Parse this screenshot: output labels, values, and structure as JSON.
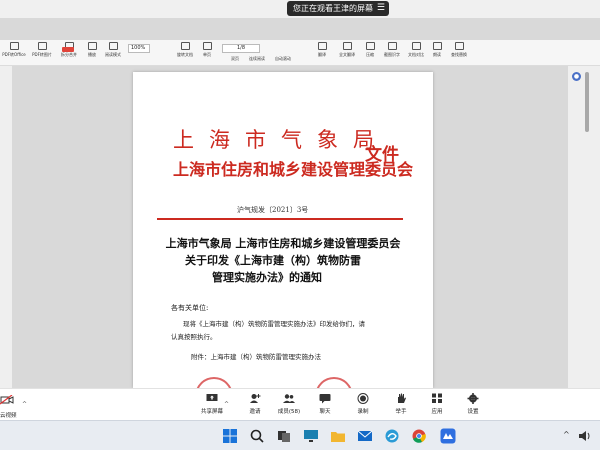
{
  "share_notice": {
    "text": "您正在观看王津的屏幕",
    "menu_icon": "menu-icon"
  },
  "toolbar": {
    "items": [
      {
        "label": "PDF转Office",
        "icon": "convert-icon"
      },
      {
        "label": "PDF转图片",
        "icon": "image-icon"
      },
      {
        "label": "拆分合并",
        "icon": "split-icon"
      },
      {
        "label": "播放",
        "icon": "play-icon"
      },
      {
        "label": "阅读模式",
        "icon": "read-icon"
      },
      {
        "label": "旋转文档",
        "icon": "rotate-icon"
      },
      {
        "label": "单页",
        "icon": "single-page-icon"
      },
      {
        "label": "双页",
        "icon": "double-page-icon"
      },
      {
        "label": "连续阅读",
        "icon": "continuous-icon"
      },
      {
        "label": "自动滚动",
        "icon": "autoscroll-icon"
      },
      {
        "label": "翻译",
        "icon": "translate-icon"
      },
      {
        "label": "全文翻译",
        "icon": "full-translate-icon"
      },
      {
        "label": "压缩",
        "icon": "compress-icon"
      },
      {
        "label": "截图识字",
        "icon": "ocr-icon"
      },
      {
        "label": "文档对比",
        "icon": "compare-icon"
      },
      {
        "label": "朗读",
        "icon": "speak-icon"
      },
      {
        "label": "查找替换",
        "icon": "search-icon"
      }
    ],
    "zoom": "100%",
    "page_indicator": "1/8",
    "view_single_label": "单页",
    "view_double_label": "双页",
    "view_continuous_label": "连续阅读",
    "autoscroll_label": "自动滚动",
    "screenshot_label": "截图识字"
  },
  "document": {
    "org_line1": "上海市气象局",
    "org_line2": "上海市住房和城乡建设管理委员会",
    "doc_type": "文件",
    "doc_number": "沪气规发〔2021〕3号",
    "title_line1": "上海市气象局 上海市住房和城乡建设管理委员会",
    "title_line2": "关于印发《上海市建（构）筑物防雷",
    "title_line3": "管理实施办法》的通知",
    "salutation": "各有关单位:",
    "body_line1": "现将《上海市建（构）筑物防雷管理实施办法》印发给你们，请",
    "body_line2": "认真按照执行。",
    "attachment": "附件：上海市建（构）筑物防雷管理实施办法",
    "seal_color": "#cc2a20"
  },
  "meeting_bar": {
    "left_label": "云视频",
    "items": [
      {
        "label": "共享屏幕",
        "icon": "share-screen-icon"
      },
      {
        "label": "邀请",
        "icon": "invite-icon"
      },
      {
        "label": "成员(58)",
        "icon": "members-icon"
      },
      {
        "label": "聊天",
        "icon": "chat-icon"
      },
      {
        "label": "录制",
        "icon": "record-icon"
      },
      {
        "label": "举手",
        "icon": "raise-hand-icon"
      },
      {
        "label": "应用",
        "icon": "apps-icon"
      },
      {
        "label": "设置",
        "icon": "settings-icon"
      }
    ]
  },
  "taskbar": {
    "apps": [
      "windows-start-icon",
      "search-icon",
      "task-view-icon",
      "monitor-icon",
      "file-explorer-icon",
      "mail-icon",
      "edge-icon",
      "chrome-icon",
      "meeting-app-icon"
    ],
    "tray_caret": "^"
  },
  "colors": {
    "doc_red": "#cc2a20",
    "accent": "#4a70c7"
  }
}
